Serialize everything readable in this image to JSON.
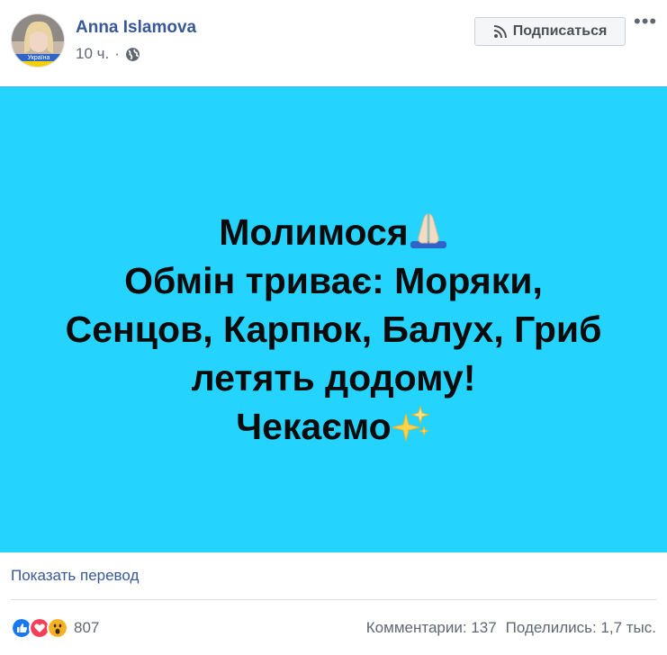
{
  "post": {
    "author": "Anna Islamova",
    "time": "10 ч.",
    "separator": "·",
    "visibility_icon": "globe-icon",
    "avatar_badge": "Україна",
    "subscribe_label": "Подписаться",
    "subscribe_icon": "rss-icon",
    "more_label": "•••"
  },
  "image": {
    "background": "#25d4fe",
    "lines": [
      "Молимося",
      "Обмін триває: Моряки,",
      "Сенцов, Карпюк, Балух, Гриб",
      "летять додому!",
      "Чекаємо"
    ],
    "emojis": [
      "folded-hands-emoji",
      "sparkles-emoji"
    ]
  },
  "footer": {
    "translate_label": "Показать перевод",
    "reaction_icons": [
      "like-icon",
      "love-icon",
      "wow-icon"
    ],
    "reaction_count": "807",
    "comments": "Комментарии: 137",
    "shares": "Поделились: 1,7 тыс."
  },
  "colors": {
    "link": "#385898",
    "muted": "#606770",
    "like": "#1877f2",
    "love": "#f33e58",
    "wow": "#f7b125"
  }
}
